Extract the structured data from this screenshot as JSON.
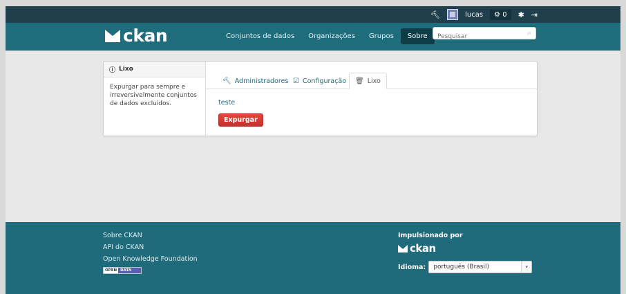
{
  "account": {
    "username": "lucas",
    "activity_count": "0"
  },
  "header": {
    "logo_text": "ckan",
    "nav": [
      {
        "label": "Conjuntos de dados"
      },
      {
        "label": "Organizações"
      },
      {
        "label": "Grupos"
      },
      {
        "label": "Sobre"
      }
    ],
    "search_placeholder": "Pesquisar"
  },
  "sidebar": {
    "title": "Lixo",
    "description": "Expurgar para sempre e irreversivelmente conjuntos de dados excluídos."
  },
  "tabs": [
    {
      "label": "Administradores"
    },
    {
      "label": "Configuração"
    },
    {
      "label": "Lixo"
    }
  ],
  "trash": {
    "item": "teste",
    "purge_button": "Expurgar"
  },
  "footer": {
    "links": [
      {
        "label": "Sobre CKAN"
      },
      {
        "label": "API do CKAN"
      },
      {
        "label": "Open Knowledge Foundation"
      }
    ],
    "badge_open": "OPEN",
    "badge_data": "DATA",
    "powered_by": "Impulsionado por",
    "logo_text": "ckan",
    "language_label": "Idioma:",
    "language_selected": "português (Brasil)"
  },
  "colors": {
    "masthead": "#1e6c7c",
    "account_bar": "#1f3f4c",
    "danger": "#d9403a",
    "footer": "#1f6b7b"
  }
}
